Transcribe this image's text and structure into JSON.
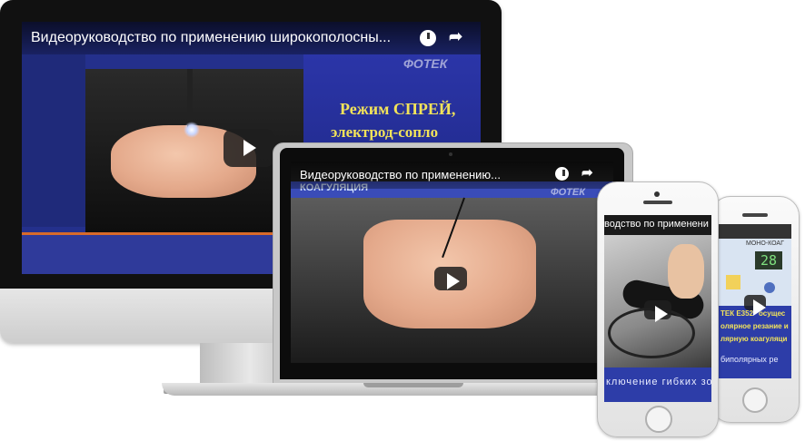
{
  "desktop": {
    "video_title": "Видеоруководство по применению широкополосны...",
    "logo": "ФОТЕК",
    "caption_line1": "Режим СПРЕЙ,",
    "caption_line2": "электрод-сопло"
  },
  "laptop": {
    "video_title": "Видеоруководство по применению...",
    "label": "КОАГУЛЯЦИЯ",
    "logo": "ФОТЕК"
  },
  "phone_left": {
    "video_title": "водство по применени",
    "caption": "ключение гибких зо"
  },
  "phone_right": {
    "device_label": "МОНО-КОАГ",
    "display_value": "28",
    "caption_line1": "ТЕК  Е352\" осущес",
    "caption_line2": "олярное резание и",
    "caption_line3": "лярную коагуляци",
    "caption_line4": "биполярных ре"
  },
  "colors": {
    "video_blue": "#24308c",
    "accent_orange": "#d86a2a",
    "caption_yellow": "#f2e35a"
  }
}
